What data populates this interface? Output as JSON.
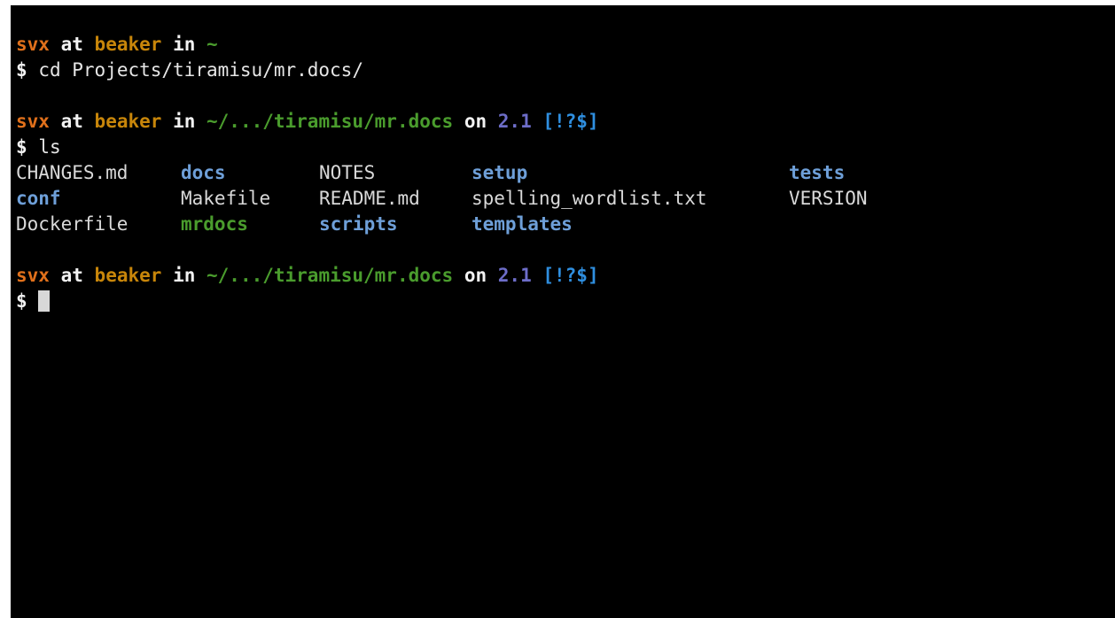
{
  "prompt1": {
    "user": "svx",
    "at": "at",
    "host": "beaker",
    "in": "in",
    "path": "~",
    "dollar": "$",
    "command": "cd Projects/tiramisu/mr.docs/"
  },
  "prompt2": {
    "user": "svx",
    "at": "at",
    "host": "beaker",
    "in": "in",
    "path": "~/.../tiramisu/mr.docs",
    "on": "on",
    "branch": "2.1",
    "status": "[!?$]",
    "dollar": "$",
    "command": "ls"
  },
  "ls_output": {
    "rows": [
      [
        {
          "name": "CHANGES.md",
          "kind": "file"
        },
        {
          "name": "docs",
          "kind": "dir"
        },
        {
          "name": "NOTES",
          "kind": "file"
        },
        {
          "name": "setup",
          "kind": "dir"
        },
        {
          "name": "tests",
          "kind": "dir"
        }
      ],
      [
        {
          "name": "conf",
          "kind": "dir"
        },
        {
          "name": "Makefile",
          "kind": "file"
        },
        {
          "name": "README.md",
          "kind": "file"
        },
        {
          "name": "spelling_wordlist.txt",
          "kind": "file"
        },
        {
          "name": "VERSION",
          "kind": "file"
        }
      ],
      [
        {
          "name": "Dockerfile",
          "kind": "file"
        },
        {
          "name": "mrdocs",
          "kind": "exec"
        },
        {
          "name": "scripts",
          "kind": "dir"
        },
        {
          "name": "templates",
          "kind": "dir"
        },
        {
          "name": "",
          "kind": "file"
        }
      ]
    ]
  },
  "prompt3": {
    "user": "svx",
    "at": "at",
    "host": "beaker",
    "in": "in",
    "path": "~/.../tiramisu/mr.docs",
    "on": "on",
    "branch": "2.1",
    "status": "[!?$]",
    "dollar": "$"
  },
  "colors": {
    "background": "#000000",
    "user": "#e0701b",
    "host": "#c8860a",
    "path": "#4a9c2d",
    "branch": "#6d6dc8",
    "status": "#2f8fe0",
    "directory": "#6e9fd8",
    "executable": "#4a9c2d"
  }
}
